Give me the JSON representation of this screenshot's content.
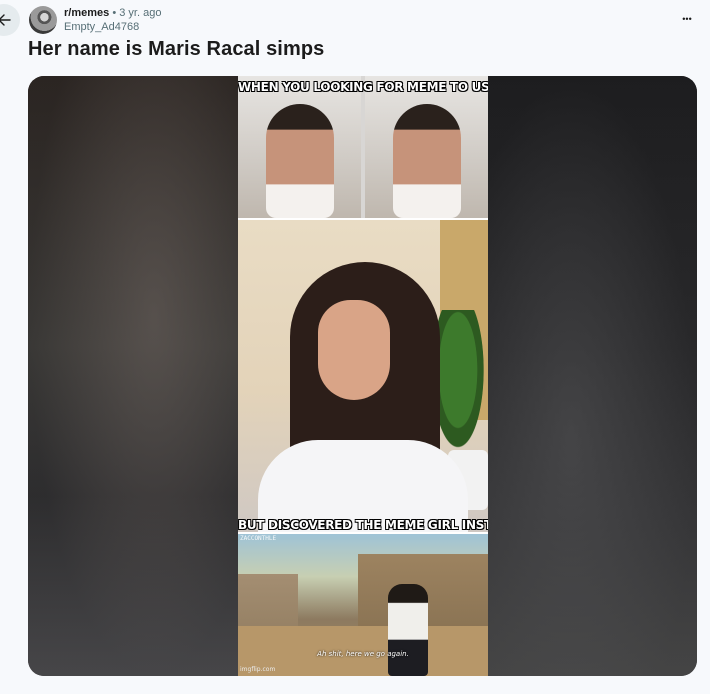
{
  "header": {
    "subreddit": "r/memes",
    "separator": "•",
    "age": "3 yr. ago",
    "username": "Empty_Ad4768",
    "back_icon": "arrow-left-icon",
    "more_icon": "ellipsis-horizontal-icon",
    "more_glyph": "•••"
  },
  "post": {
    "title": "Her name is Maris Racal simps"
  },
  "meme": {
    "top_caption": "WHEN YOU LOOKING FOR MEME TO USE",
    "bottom_caption": "BUT DISCOVERED THE MEME GIRL INSTEAD",
    "watermark": "ZACCONTHLE",
    "subtitle": "Ah shit, here we go again.",
    "credit": "imgflip.com"
  }
}
